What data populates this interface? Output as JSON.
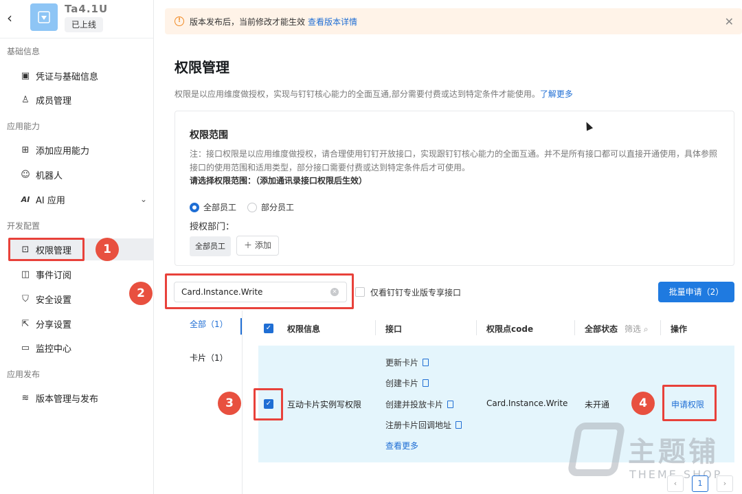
{
  "app": {
    "name": "Ta4.1U",
    "status": "已上线"
  },
  "sidebar": {
    "groups": [
      {
        "title": "基础信息"
      },
      {
        "title": "应用能力"
      },
      {
        "title": "开发配置"
      },
      {
        "title": "应用发布"
      }
    ],
    "items": [
      {
        "label": "凭证与基础信息",
        "icon": "credential-icon"
      },
      {
        "label": "成员管理",
        "icon": "user-icon"
      },
      {
        "label": "添加应用能力",
        "icon": "apps-icon"
      },
      {
        "label": "机器人",
        "icon": "robot-icon"
      },
      {
        "label": "AI 应用",
        "icon": "ai-icon",
        "icon_text": "AI"
      },
      {
        "label": "权限管理",
        "icon": "lock-icon"
      },
      {
        "label": "事件订阅",
        "icon": "subscribe-icon"
      },
      {
        "label": "安全设置",
        "icon": "shield-icon"
      },
      {
        "label": "分享设置",
        "icon": "share-icon"
      },
      {
        "label": "监控中心",
        "icon": "monitor-icon"
      },
      {
        "label": "版本管理与发布",
        "icon": "layers-icon"
      }
    ]
  },
  "notice": {
    "text": "版本发布后，当前修改才能生效",
    "link": "查看版本详情",
    "accent": "#f08a24"
  },
  "page": {
    "title": "权限管理",
    "desc": "权限是以应用维度做授权，实现与钉钉核心能力的全面互通,部分需要付费或达到特定条件才能使用。",
    "desc_link": "了解更多"
  },
  "scope": {
    "title": "权限范围",
    "note": "注：接口权限是以应用维度做授权，请合理使用钉钉开放接口，实现跟钉钉核心能力的全面互通。并不是所有接口都可以直接开通使用，具体参照接口的使用范围和适用类型，部分接口需要付费或达到特定条件后才可使用。",
    "choose": "请选择权限范围：（添加通讯录接口权限后生效）",
    "options": [
      "全部员工",
      "部分员工"
    ],
    "selected": "全部员工",
    "dept_label": "授权部门：",
    "dept_tag": "全部员工",
    "add_label": "添加"
  },
  "toolbar": {
    "search_value": "Card.Instance.Write",
    "only_label": "仅看钉钉专业版专享接口",
    "batch_label": "批量申请（2）",
    "primary": "#1f7ae0"
  },
  "categories": [
    {
      "label": "全部（1）",
      "active": true
    },
    {
      "label": "卡片（1）",
      "active": false
    }
  ],
  "table": {
    "headers": [
      "权限信息",
      "接口",
      "权限点code",
      "全部状态",
      "操作"
    ],
    "filter_label": "筛选",
    "row": {
      "name": "互动卡片实例写权限",
      "apis": [
        "更新卡片",
        "创建卡片",
        "创建并投放卡片",
        "注册卡片回调地址"
      ],
      "more": "查看更多",
      "code": "Card.Instance.Write",
      "status": "未开通",
      "action": "申请权限"
    }
  },
  "steps": [
    "1",
    "2",
    "3",
    "4"
  ],
  "step_color": "#e8503f",
  "watermark": {
    "text": "主题铺",
    "sub": "THEME SHOP"
  },
  "pagination": {
    "current": "1"
  }
}
